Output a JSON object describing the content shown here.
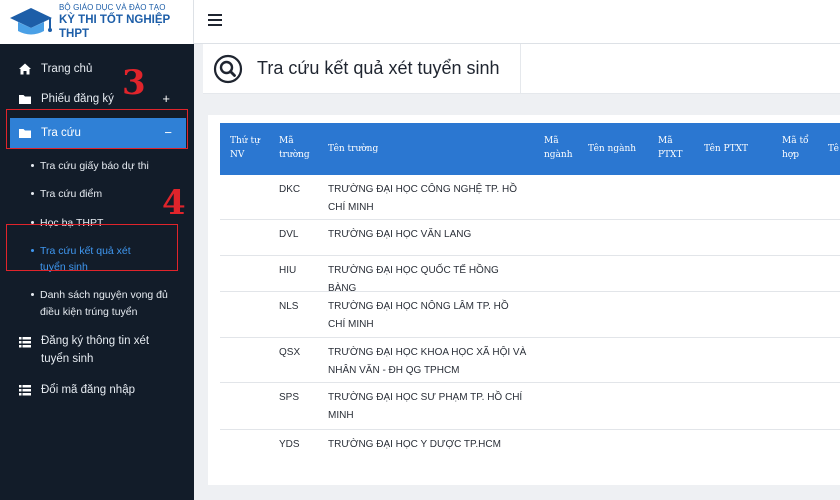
{
  "brand": {
    "line1": "BỘ GIÁO DỤC VÀ ĐÀO TẠO",
    "line2": "KỲ THI TỐT NGHIỆP THPT",
    "accent_color": "#1d5ea8"
  },
  "sidebar": {
    "background": "#121c29",
    "active_color": "#2f80d6",
    "items": [
      {
        "label": "Trang chủ",
        "icon": "home-icon"
      },
      {
        "label": "Phiếu đăng ký",
        "icon": "folder-icon",
        "sign": "+"
      },
      {
        "label": "Tra cứu",
        "icon": "folder-icon",
        "sign": "−",
        "active": true
      },
      {
        "label": "Đăng ký thông tin xét tuyển sinh",
        "icon": "list-icon"
      },
      {
        "label": "Đổi mã đăng nhập",
        "icon": "list-icon"
      }
    ],
    "sub_items": [
      {
        "label": "Tra cứu giấy báo dự thi"
      },
      {
        "label": "Tra cứu điểm"
      },
      {
        "label": "Học bạ THPT"
      },
      {
        "label": "Tra cứu kết quả xét tuyển sinh",
        "current": true
      },
      {
        "label": "Danh sách nguyện vọng đủ điều kiện trúng tuyển"
      }
    ]
  },
  "annotations": {
    "step3": "3",
    "step4": "4",
    "color": "#e0242b"
  },
  "page": {
    "title": "Tra cứu kết quả xét tuyển sinh"
  },
  "table": {
    "header_color": "#2b77d1",
    "headers": [
      "Thứ tự NV",
      "Mã trường",
      "Tên trường",
      "Mã ngành",
      "Tên ngành",
      "Mã PTXT",
      "Tên PTXT",
      "Mã tổ hợp",
      "Tê"
    ],
    "rows": [
      {
        "code": "DKC",
        "name": "TRƯỜNG ĐẠI HỌC CÔNG NGHỆ TP. HỒ CHÍ MINH"
      },
      {
        "code": "DVL",
        "name": "TRƯỜNG ĐẠI HỌC VĂN LANG"
      },
      {
        "code": "HIU",
        "name": "TRƯỜNG ĐẠI HỌC QUỐC TẾ HỒNG BÀNG"
      },
      {
        "code": "NLS",
        "name": "TRƯỜNG ĐẠI HỌC NÔNG LÂM TP. HỒ CHÍ MINH"
      },
      {
        "code": "QSX",
        "name": "TRƯỜNG ĐẠI HỌC KHOA HỌC XÃ HỘI VÀ NHÂN VĂN - ĐH QG TPHCM"
      },
      {
        "code": "SPS",
        "name": "TRƯỜNG ĐẠI HỌC SƯ PHẠM TP. HỒ CHÍ MINH"
      },
      {
        "code": "YDS",
        "name": "TRƯỜNG ĐẠI HỌC Y DƯỢC TP.HCM"
      }
    ]
  }
}
